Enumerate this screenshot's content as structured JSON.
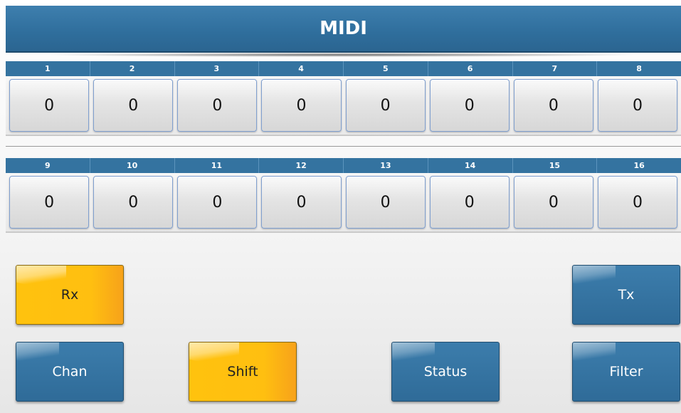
{
  "title": "MIDI",
  "row1": {
    "headers": [
      "1",
      "2",
      "3",
      "4",
      "5",
      "6",
      "7",
      "8"
    ],
    "values": [
      "0",
      "0",
      "0",
      "0",
      "0",
      "0",
      "0",
      "0"
    ]
  },
  "row2": {
    "headers": [
      "9",
      "10",
      "11",
      "12",
      "13",
      "14",
      "15",
      "16"
    ],
    "values": [
      "0",
      "0",
      "0",
      "0",
      "0",
      "0",
      "0",
      "0"
    ]
  },
  "buttons": {
    "rx": "Rx",
    "tx": "Tx",
    "chan": "Chan",
    "shift": "Shift",
    "status": "Status",
    "filter": "Filter"
  },
  "colors": {
    "accent_blue": "#2f6e9c",
    "selected_yellow": "#ffc20e"
  }
}
